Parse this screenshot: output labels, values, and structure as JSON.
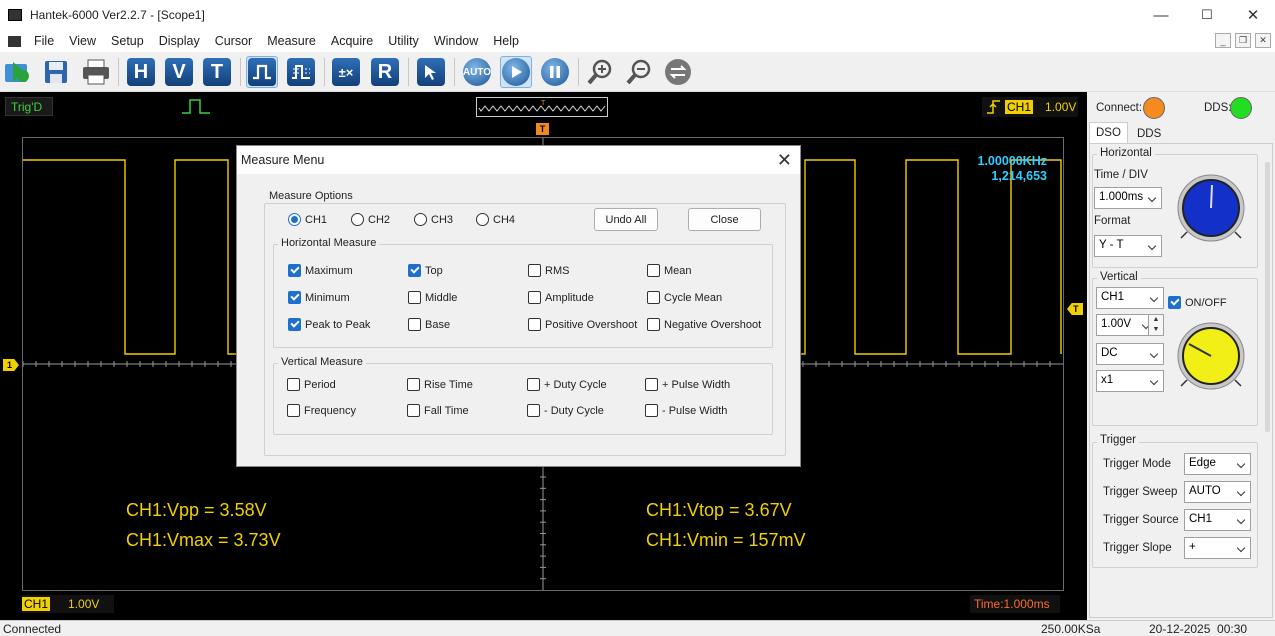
{
  "window": {
    "title": "Hantek-6000 Ver2.2.7 - [Scope1]",
    "minimize": "—",
    "maximize": "☐",
    "close": "✕"
  },
  "menu": {
    "items": [
      "File",
      "View",
      "Setup",
      "Display",
      "Cursor",
      "Measure",
      "Acquire",
      "Utility",
      "Window",
      "Help"
    ]
  },
  "toolbar": {
    "h": "H",
    "v": "V",
    "t": "T",
    "r": "R",
    "auto": "AUTO"
  },
  "scope": {
    "trig_status": "Trig'D",
    "trigger_label": "CH1",
    "trigger_level": "1.00V",
    "freq": "1.00000KHz",
    "count": "1,214,653",
    "trigger_marker": "T",
    "ch_marker": "1",
    "measurements": {
      "vpp": "CH1:Vpp = 3.58V",
      "vmax": "CH1:Vmax = 3.73V",
      "vtop": "CH1:Vtop = 3.67V",
      "vmin": "CH1:Vmin = 157mV"
    },
    "ch1_tag": "CH1",
    "ch1_scale": "1.00V",
    "time_scale": "Time:1.000ms",
    "waveform_color": "#f0d000"
  },
  "panel": {
    "connect_label": "Connect:",
    "dds_label": "DDS:",
    "connect_color": "#f58a1f",
    "dds_color": "#22dd22",
    "tabs": [
      "DSO",
      "DDS"
    ],
    "horizontal": {
      "title": "Horizontal",
      "time_label": "Time / DIV",
      "time_value": "1.000ms",
      "format_label": "Format",
      "format_value": "Y - T"
    },
    "vertical": {
      "title": "Vertical",
      "channel": "CH1",
      "onoff": "ON/OFF",
      "volts": "1.00V",
      "coupling": "DC",
      "probe": "x1"
    },
    "trigger": {
      "title": "Trigger",
      "rows": [
        {
          "label": "Trigger Mode",
          "value": "Edge"
        },
        {
          "label": "Trigger Sweep",
          "value": "AUTO"
        },
        {
          "label": "Trigger Source",
          "value": "CH1"
        },
        {
          "label": "Trigger Slope",
          "value": "+"
        }
      ]
    }
  },
  "dialog": {
    "title": "Measure Menu",
    "close_glyph": "✕",
    "options_title": "Measure Options",
    "channels": [
      {
        "label": "CH1",
        "selected": true
      },
      {
        "label": "CH2",
        "selected": false
      },
      {
        "label": "CH3",
        "selected": false
      },
      {
        "label": "CH4",
        "selected": false
      }
    ],
    "undo_all": "Undo All",
    "close_btn": "Close",
    "horizontal_title": "Horizontal Measure",
    "horizontal": [
      {
        "label": "Maximum",
        "checked": true
      },
      {
        "label": "Top",
        "checked": true
      },
      {
        "label": "RMS",
        "checked": false
      },
      {
        "label": "Mean",
        "checked": false
      },
      {
        "label": "Minimum",
        "checked": true
      },
      {
        "label": "Middle",
        "checked": false
      },
      {
        "label": "Amplitude",
        "checked": false
      },
      {
        "label": "Cycle Mean",
        "checked": false
      },
      {
        "label": "Peak to Peak",
        "checked": true
      },
      {
        "label": "Base",
        "checked": false
      },
      {
        "label": "Positive Overshoot",
        "checked": false
      },
      {
        "label": "Negative Overshoot",
        "checked": false
      }
    ],
    "vertical_title": "Vertical Measure",
    "vertical": [
      {
        "label": "Period",
        "checked": false
      },
      {
        "label": "Rise Time",
        "checked": false
      },
      {
        "label": "+ Duty Cycle",
        "checked": false
      },
      {
        "label": "+ Pulse Width",
        "checked": false
      },
      {
        "label": "Frequency",
        "checked": false
      },
      {
        "label": "Fall Time",
        "checked": false
      },
      {
        "label": "- Duty Cycle",
        "checked": false
      },
      {
        "label": "- Pulse Width",
        "checked": false
      }
    ]
  },
  "status": {
    "left": "Connected",
    "rate": "250.00KSa",
    "datetime": "20-12-2025  00:30"
  }
}
